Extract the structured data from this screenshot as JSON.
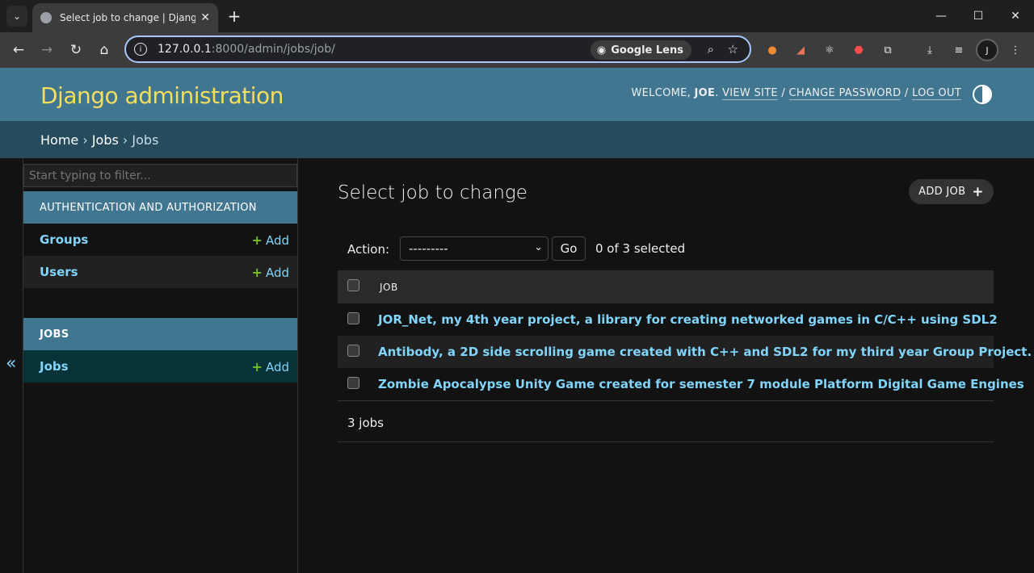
{
  "browser": {
    "tab_title": "Select job to change | Django site admin",
    "tab_close": "✕",
    "new_tab": "+",
    "url_host": "127.0.0.1",
    "url_rest": ":8000/admin/jobs/job/",
    "lens_label": "Google Lens",
    "avatar_letter": "J",
    "window": {
      "minimize": "—",
      "maximize": "☐",
      "close": "✕"
    }
  },
  "header": {
    "site_name": "Django administration",
    "welcome": "WELCOME, ",
    "user": "JOE",
    "view_site": "VIEW SITE",
    "change_password": "CHANGE PASSWORD",
    "log_out": "LOG OUT"
  },
  "breadcrumbs": {
    "home": "Home",
    "app": "Jobs",
    "model": "Jobs"
  },
  "sidebar": {
    "collapse_glyph": "«",
    "filter_placeholder": "Start typing to filter...",
    "modules": [
      {
        "caption": "AUTHENTICATION AND AUTHORIZATION",
        "rows": [
          {
            "name": "Groups",
            "add": "Add"
          },
          {
            "name": "Users",
            "add": "Add"
          }
        ]
      },
      {
        "caption": "JOBS",
        "rows": [
          {
            "name": "Jobs",
            "add": "Add"
          }
        ]
      }
    ]
  },
  "main": {
    "title": "Select job to change",
    "add_button": "ADD JOB",
    "action_label": "Action:",
    "action_selected": "---------",
    "go_button": "Go",
    "selection_count": "0 of 3 selected",
    "column_header": "JOB",
    "rows": [
      "JOR_Net, my 4th year project, a library for creating networked games in C/C++ using SDL2",
      "Antibody, a 2D side scrolling game created with C++ and SDL2 for my third year Group Project.",
      "Zombie Apocalypse Unity Game created for semester 7 module Platform Digital Game Engines"
    ],
    "result_count": "3 jobs"
  },
  "colors": {
    "header_bg": "#417690",
    "branding": "#f5dd5d",
    "breadcrumbs_bg": "#264b5d",
    "link": "#81d4fa",
    "add_plus": "#70bf2b"
  }
}
